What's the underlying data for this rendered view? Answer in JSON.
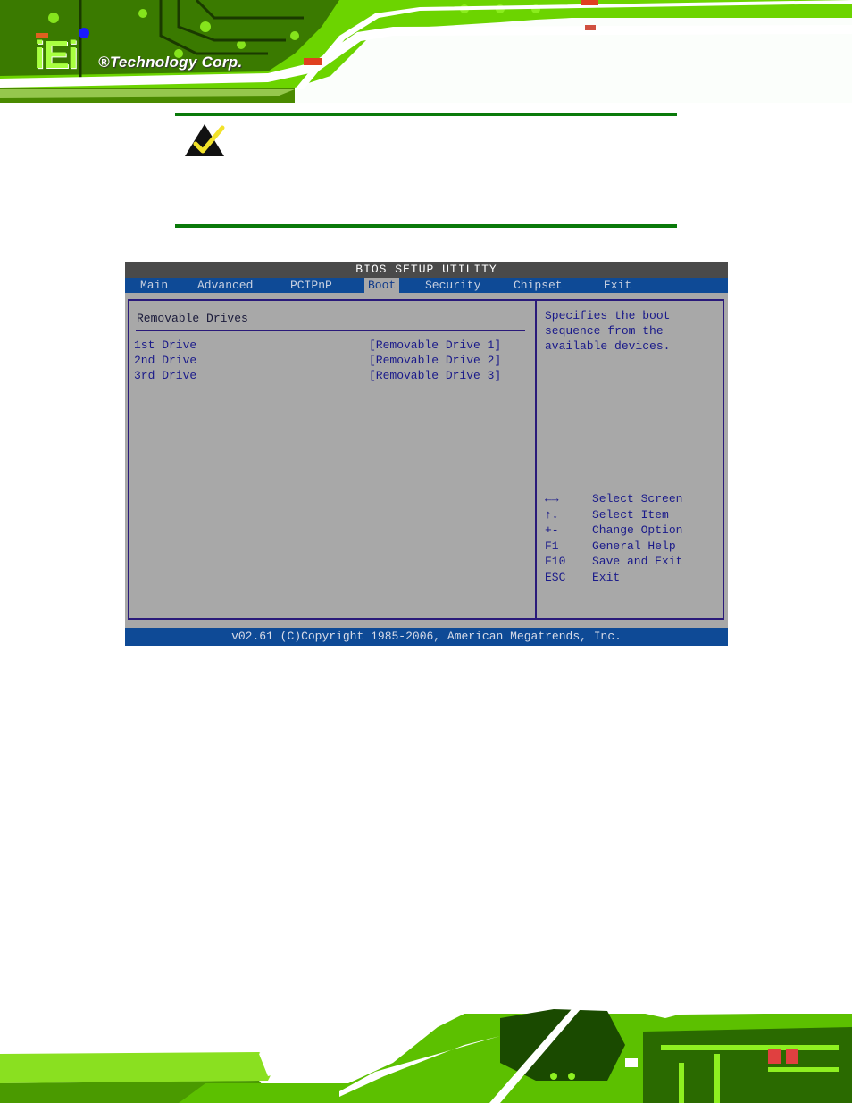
{
  "header": {
    "logo_mark": "iEi",
    "logo_text": "®Technology Corp.",
    "colors": {
      "circuit_green": "#7ee000",
      "dark_green": "#1a3a00",
      "logo_dot": "#1a1aff"
    }
  },
  "note": {
    "icon": "check-warning-icon",
    "line_color": "#0a7a0a"
  },
  "bios": {
    "title": "BIOS SETUP UTILITY",
    "menu": [
      {
        "label": "Main",
        "active": false
      },
      {
        "label": "Advanced",
        "active": false
      },
      {
        "label": "PCIPnP",
        "active": false
      },
      {
        "label": "Boot",
        "active": true
      },
      {
        "label": "Security",
        "active": false
      },
      {
        "label": "Chipset",
        "active": false
      },
      {
        "label": "Exit",
        "active": false
      }
    ],
    "section_title": "Removable Drives",
    "items": [
      {
        "label": "1st Drive",
        "value": "[Removable Drive 1]"
      },
      {
        "label": "2nd Drive",
        "value": "[Removable Drive 2]"
      },
      {
        "label": "3rd Drive",
        "value": "[Removable Drive 3]"
      }
    ],
    "help_text": [
      "Specifies the boot",
      "sequence from the",
      "available devices."
    ],
    "keys": [
      {
        "key": "←→",
        "action": "Select Screen"
      },
      {
        "key": "↑↓",
        "action": "Select Item"
      },
      {
        "key": "+-",
        "action": "Change Option"
      },
      {
        "key": "F1",
        "action": "General Help"
      },
      {
        "key": "F10",
        "action": "Save and Exit"
      },
      {
        "key": "ESC",
        "action": "Exit"
      }
    ],
    "footer": "v02.61 (C)Copyright 1985-2006, American Megatrends, Inc.",
    "colors": {
      "bg": "#a8a8a8",
      "menubar": "#0e4a96",
      "title_bar": "#4a4a4a",
      "text": "#1a1a8a",
      "border": "#2a1a7a"
    }
  }
}
